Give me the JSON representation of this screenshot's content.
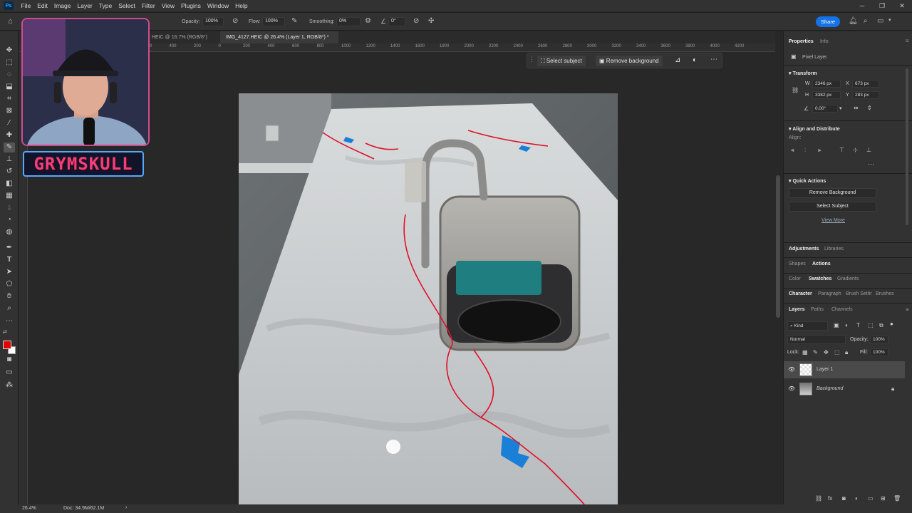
{
  "menu": [
    "File",
    "Edit",
    "Image",
    "Layer",
    "Type",
    "Select",
    "Filter",
    "View",
    "Plugins",
    "Window",
    "Help"
  ],
  "app_badge": "Ps",
  "options": {
    "opacity_label": "Opacity:",
    "opacity_value": "100%",
    "flow_label": "Flow:",
    "flow_value": "100%",
    "smoothing_label": "Smoothing:",
    "smoothing_value": "0%",
    "angle_value": "0°",
    "share_label": "Share"
  },
  "tabs": [
    {
      "label": "IMG_...HEIC @ 16.7% (RGB/8*)",
      "visible": "HEIC @ 16.7% (RGB/8*)"
    },
    {
      "label": "IMG_4127.HEIC @ 26.4% (Layer 1, RGB/8*) *"
    }
  ],
  "ruler": [
    "600",
    "400",
    "200",
    "0",
    "200",
    "400",
    "600",
    "800",
    "1000",
    "1200",
    "1400",
    "1600",
    "1800",
    "2000",
    "2200",
    "2400",
    "2600",
    "2800",
    "3000",
    "3200",
    "3400",
    "3600",
    "3800",
    "4000",
    "4200"
  ],
  "context_bar": {
    "select_subject": "Select subject",
    "remove_background": "Remove background"
  },
  "status": {
    "zoom": "26.4%",
    "doc": "Doc: 34.9M/62.1M"
  },
  "streamer": {
    "name": "GRYMSKULL"
  },
  "panel": {
    "top_tabs": [
      "Properties",
      "Info"
    ],
    "layer_type": "Pixel Layer",
    "transform_title": "Transform",
    "w_label": "W",
    "w_value": "2346 px",
    "h_label": "H",
    "h_value": "3382 px",
    "x_label": "X",
    "x_value": "673 px",
    "y_label": "Y",
    "y_value": "283 px",
    "angle_value": "0.00°",
    "align_title": "Align and Distribute",
    "align_label": "Align:",
    "quick_title": "Quick Actions",
    "remove_bg": "Remove Background",
    "select_subject": "Select Subject",
    "view_more": "View More",
    "adj_tabs": [
      "Adjustments",
      "Libraries"
    ],
    "shape_tabs": [
      "Shapes",
      "Actions"
    ],
    "color_tabs": [
      "Color",
      "Swatches",
      "Gradients"
    ],
    "char_tabs": [
      "Character",
      "Paragraph",
      "Brush Settir",
      "Brushes"
    ],
    "layer_tabs": [
      "Layers",
      "Paths",
      "Channels"
    ],
    "kind": "Kind",
    "blend": "Normal",
    "opacity_label": "Opacity:",
    "opacity_value": "100%",
    "lock_label": "Lock:",
    "fill_label": "Fill:",
    "fill_value": "100%",
    "layers": [
      "Layer 1",
      "Background"
    ]
  },
  "colors": {
    "accent": "#1473e6",
    "foreground": "#e00000",
    "background": "#ffffff",
    "markup": "#e0102a",
    "tape": "#1a7fd6"
  }
}
